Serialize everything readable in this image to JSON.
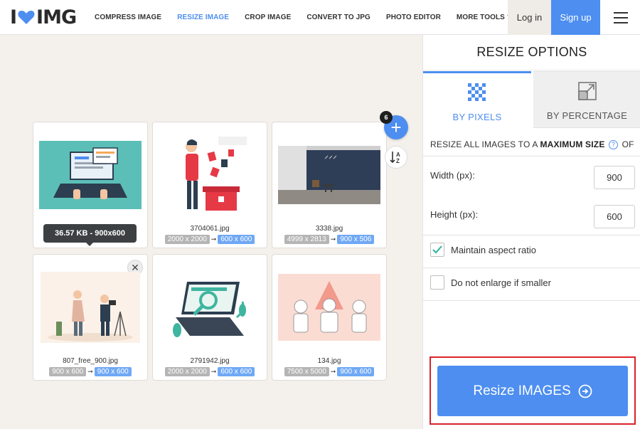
{
  "header": {
    "logo_left": "I",
    "logo_right": "IMG",
    "nav": [
      {
        "label": "COMPRESS IMAGE",
        "active": false
      },
      {
        "label": "RESIZE IMAGE",
        "active": true
      },
      {
        "label": "CROP IMAGE",
        "active": false
      },
      {
        "label": "CONVERT TO JPG",
        "active": false
      },
      {
        "label": "PHOTO EDITOR",
        "active": false
      },
      {
        "label": "MORE TOOLS",
        "active": false
      }
    ],
    "login": "Log in",
    "signup": "Sign up",
    "colors": {
      "accent": "#4d8ef0",
      "logo_heart": "#4d8ef0"
    }
  },
  "workspace": {
    "add_count": "6",
    "tooltip": "36.57 KB - 900x600",
    "files": [
      {
        "name": "",
        "old": "",
        "new": "",
        "icon": "laptop-illustration"
      },
      {
        "name": "3704061.jpg",
        "old": "2000 x 2000",
        "new": "600 x 600",
        "icon": "person-with-boxes-illustration"
      },
      {
        "name": "3338.jpg",
        "old": "4999 x 2813",
        "new": "900 x 506",
        "icon": "room-interior-photo"
      },
      {
        "name": "807_free_900.jpg",
        "old": "900 x 600",
        "new": "900 x 600",
        "icon": "photographers-illustration"
      },
      {
        "name": "2791942.jpg",
        "old": "2000 x 2000",
        "new": "600 x 600",
        "icon": "laptop-search-illustration"
      },
      {
        "name": "134.jpg",
        "old": "7500 x 5000",
        "new": "900 x 600",
        "icon": "people-doodle-illustration"
      }
    ]
  },
  "panel": {
    "title": "RESIZE OPTIONS",
    "tab_pixels": "BY PIXELS",
    "tab_percentage": "BY PERCENTAGE",
    "desc_prefix": "RESIZE ALL IMAGES TO A ",
    "desc_bold": "MAXIMUM SIZE",
    "desc_suffix": " OF",
    "width_label": "Width (px):",
    "width_value": "900",
    "height_label": "Height (px):",
    "height_value": "600",
    "maintain_label": "Maintain aspect ratio",
    "maintain_checked": true,
    "noenlarge_label": "Do not enlarge if smaller",
    "noenlarge_checked": false,
    "resize_button": "Resize IMAGES",
    "colors": {
      "button": "#4d8ef0",
      "highlight": "#d9232a",
      "check": "#29b39a"
    }
  }
}
